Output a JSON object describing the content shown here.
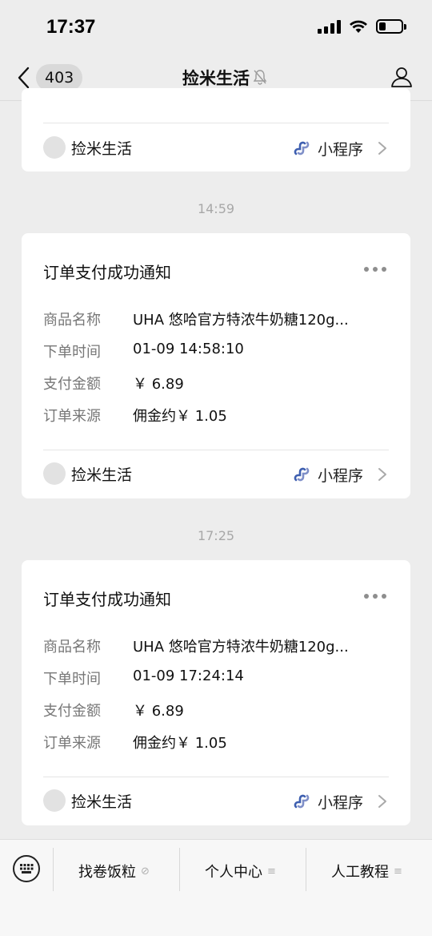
{
  "status": {
    "time": "17:37"
  },
  "nav": {
    "badge": "403",
    "title": "捡米生活"
  },
  "card0": {
    "account_name": "捡米生活",
    "mini_label": "小程序"
  },
  "messages": [
    {
      "time": "14:59",
      "title": "订单支付成功通知",
      "fields": [
        {
          "label": "商品名称",
          "value": "UHA 悠哈官方特浓牛奶糖120g..."
        },
        {
          "label": "下单时间",
          "value": "01-09 14:58:10"
        },
        {
          "label": "支付金额",
          "value": "￥ 6.89"
        },
        {
          "label": "订单来源",
          "value": "佣金约￥ 1.05"
        }
      ],
      "account_name": "捡米生活",
      "mini_label": "小程序"
    },
    {
      "time": "17:25",
      "title": "订单支付成功通知",
      "fields": [
        {
          "label": "商品名称",
          "value": "UHA 悠哈官方特浓牛奶糖120g..."
        },
        {
          "label": "下单时间",
          "value": "01-09 17:24:14"
        },
        {
          "label": "支付金额",
          "value": "￥ 6.89"
        },
        {
          "label": "订单来源",
          "value": "佣金约￥ 1.05"
        }
      ],
      "account_name": "捡米生活",
      "mini_label": "小程序"
    }
  ],
  "bottom_menu": [
    {
      "label": "找卷饭粒",
      "icon": "link-icon"
    },
    {
      "label": "个人中心",
      "icon": "menu-lines-icon"
    },
    {
      "label": "人工教程",
      "icon": "menu-lines-icon"
    }
  ],
  "colors": {
    "background": "#ededed",
    "card": "#ffffff",
    "mini_icon": "#3e5fb0"
  }
}
